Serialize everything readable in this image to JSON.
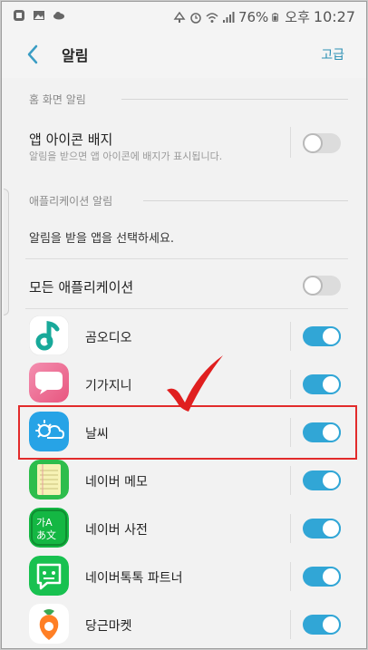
{
  "status_bar": {
    "battery": "76%",
    "ampm": "오후",
    "time": "10:27"
  },
  "header": {
    "title": "알림",
    "advanced_label": "고급"
  },
  "home_section": {
    "label": "홈 화면 알림",
    "badge_title": "앱 아이콘 배지",
    "badge_sub": "알림을 받으면 앱 아이콘에 배지가 표시됩니다.",
    "badge_on": false
  },
  "app_section": {
    "label": "애플리케이션 알림",
    "instruction": "알림을 받을 앱을 선택하세요.",
    "all_apps_label": "모든 애플리케이션",
    "all_apps_on": false
  },
  "apps": [
    {
      "name": "곰오디오",
      "on": true,
      "icon": "music-note-icon"
    },
    {
      "name": "기가지니",
      "on": true,
      "icon": "speech-bubble-icon"
    },
    {
      "name": "날씨",
      "on": true,
      "icon": "weather-icon"
    },
    {
      "name": "네이버 메모",
      "on": true,
      "icon": "notepad-icon"
    },
    {
      "name": "네이버 사전",
      "on": true,
      "icon": "dictionary-icon",
      "icon_text": "가A\nあ文"
    },
    {
      "name": "네이버톡톡 파트너",
      "on": true,
      "icon": "chat-icon"
    },
    {
      "name": "당근마켓",
      "on": true,
      "icon": "carrot-icon"
    }
  ],
  "colors": {
    "accent": "#31a6d6",
    "highlight": "#e22b2b"
  }
}
